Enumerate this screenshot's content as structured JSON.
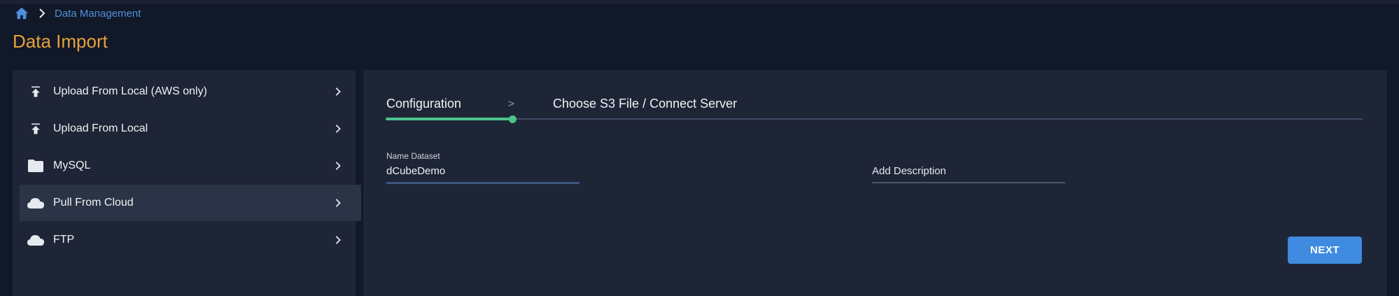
{
  "breadcrumb": {
    "link": "Data Management"
  },
  "page": {
    "title": "Data Import"
  },
  "sidebar": {
    "items": [
      {
        "label": "Upload From Local (AWS only)",
        "icon": "upload-icon"
      },
      {
        "label": "Upload From Local",
        "icon": "upload-icon"
      },
      {
        "label": "MySQL",
        "icon": "folder-icon"
      },
      {
        "label": "Pull From Cloud",
        "icon": "cloud-icon",
        "active": true
      },
      {
        "label": "FTP",
        "icon": "cloud-icon"
      }
    ]
  },
  "steps": {
    "items": [
      "Configuration",
      "Choose S3 File / Connect Server"
    ],
    "separator": ">",
    "current": 1
  },
  "form": {
    "name_label": "Name Dataset",
    "name_value": "dCubeDemo",
    "description_placeholder": "Add Description"
  },
  "actions": {
    "next_label": "NEXT"
  },
  "colors": {
    "accent": "#3e8be0",
    "title": "#e8a23a",
    "progress": "#4cc38a",
    "background": "#111827",
    "panel": "#1e2536"
  }
}
